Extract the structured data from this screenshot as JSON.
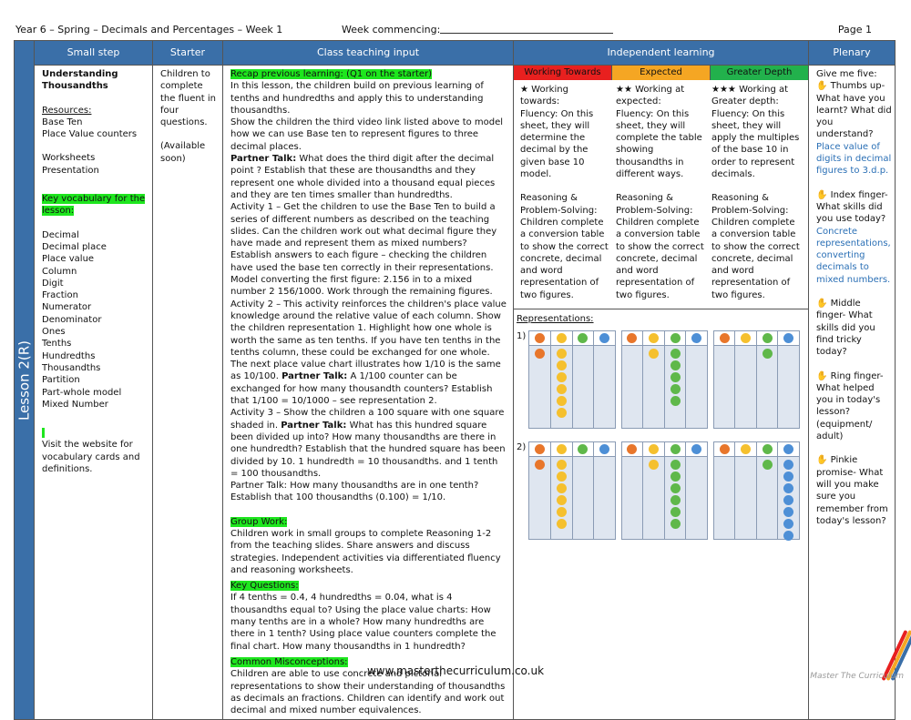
{
  "header": {
    "title": "Year 6 – Spring – Decimals and Percentages – Week 1",
    "week_commencing": "Week commencing:",
    "page": "Page 1"
  },
  "columns": {
    "small_step": "Small step",
    "starter": "Starter",
    "class_teaching": "Class teaching input",
    "independent": "Independent learning",
    "plenary": "Plenary"
  },
  "lesson_label": "Lesson 2(R)",
  "small_step": {
    "title": "Understanding Thousandths",
    "resources_heading": "Resources:",
    "resources": [
      "Base Ten",
      "Place Value counters"
    ],
    "materials": [
      "Worksheets",
      "Presentation"
    ],
    "vocab_heading": "Key vocabulary for the lesson:",
    "vocab": [
      "Decimal",
      "Decimal place",
      "Place value",
      "Column",
      "Digit",
      "Fraction",
      "Numerator",
      "Denominator",
      "Ones",
      "Tenths",
      "Hundredths",
      "Thousandths",
      "Partition",
      "Part-whole model",
      "Mixed Number"
    ],
    "website_note": "Visit the website for vocabulary cards and definitions."
  },
  "starter": {
    "text": "Children to complete the fluent in four questions.",
    "availability": "(Available soon)"
  },
  "teaching": {
    "recap_heading": "Recap previous learning: (Q1 on the starter)",
    "p1": "In this lesson, the children build on previous learning of tenths and hundredths and apply this to understanding thousandths.",
    "p2": "Show the children the third video link listed above to model how we can use Base ten to represent figures to three decimal places.",
    "pt_label": "Partner Talk:",
    "p3": "What does the third digit after the decimal point ? Establish that these are thousandths and they represent one whole divided into a thousand equal pieces and they are ten times smaller than hundredths.",
    "p4": "Activity 1 – Get the children to use the Base Ten to build a series of different numbers as described on the teaching slides. Can the children work out what decimal figure they have made and represent them as mixed numbers? Establish answers to each figure – checking the children have used the base ten correctly in their representations. Model converting the first figure: 2.156 in to a mixed number 2 156/1000. Work through the remaining figures.",
    "p5": "Activity 2 – This activity reinforces the children's place value knowledge around the relative value of each column. Show the children representation 1. Highlight how one whole is worth the same as ten tenths. If you have ten tenths in the tenths column, these could be exchanged for one whole. The next place value chart illustrates how 1/10 is the same as 10/100.",
    "p6": "A 1/100 counter can be exchanged for how many thousandth counters? Establish that 1/100 = 10/1000 – see representation 2.",
    "p7a": "Activity 3 – Show the children a 100 square with one square shaded in.",
    "p7b": "What has this hundred square been divided up into? How many thousandths are there in one hundredth? Establish that the hundred square has been divided by 10. 1 hundredth = 10 thousandths. and 1 tenth = 100 thousandths.",
    "p8": "Partner Talk: How many thousandths are in one tenth? Establish that 100 thousandths (0.100) = 1/10.",
    "group_heading": "Group Work:",
    "group_text": "Children work in small groups to complete Reasoning 1-2 from the teaching slides. Share answers and discuss strategies. Independent activities via differentiated fluency and reasoning worksheets.",
    "kq_heading": "Key Questions:",
    "kq_text": "If 4 tenths = 0.4, 4 hundredths = 0.04, what is 4 thousandths equal to? Using the place value charts: How many tenths are in a whole? How many hundredths are there in 1 tenth? Using place value counters complete the final chart. How many thousandths in 1 hundredth?",
    "cm_heading": "Common Misconceptions:",
    "cm_text": "Children are able to use concrete and pictorial representations to show their understanding of thousandths as decimals an fractions. Children can identify and work out decimal and mixed number equivalences."
  },
  "independent": {
    "levels": [
      {
        "label": "Working Towards",
        "color": "#e8201f"
      },
      {
        "label": "Expected",
        "color": "#f5a623"
      },
      {
        "label": "Greater Depth",
        "color": "#22b14c"
      }
    ],
    "wt_title": "★ Working towards:",
    "wt_fluency": "Fluency: On this sheet, they will determine the decimal by the given base 10 model.",
    "wt_reasoning": "Reasoning & Problem-Solving: Children complete a conversion table to show the correct concrete, decimal and word representation of two figures.",
    "ex_title": "★★ Working at expected:",
    "ex_fluency": "Fluency: On this sheet, they will complete the table showing thousandths in different ways.",
    "ex_reasoning": "Reasoning & Problem-Solving: Children complete a conversion table to show the correct concrete, decimal and word representation of two figures.",
    "gd_title": "★★★ Working at Greater depth:",
    "gd_fluency": "Fluency: On this sheet, they will apply the multiples of the base 10 in order to represent decimals.",
    "gd_reasoning": "Reasoning & Problem-Solving: Children complete a conversion table to show the correct concrete, decimal and word representation of two figures.",
    "reps_heading": "Representations:",
    "rep1": "1)",
    "rep2": "2)"
  },
  "plenary": {
    "intro": "Give me five:",
    "thumb": "✋ Thumbs up- What have you learnt? What did you understand?",
    "thumb_answer": "Place value of digits in decimal figures to 3.d.p.",
    "index": "✋ Index finger- What skills did you use today?",
    "index_answer": "Concrete representations, converting decimals to mixed numbers.",
    "middle": "✋ Middle finger- What skills did you find tricky today?",
    "ring": "✋ Ring finger- What helped you in today's lesson? (equipment/ adult)",
    "pinkie": "✋ Pinkie promise- What will you make sure you remember from today's lesson?"
  },
  "footer": {
    "url": "www.masterthecurriculum.co.uk",
    "brand": "Master The Curriculum"
  }
}
